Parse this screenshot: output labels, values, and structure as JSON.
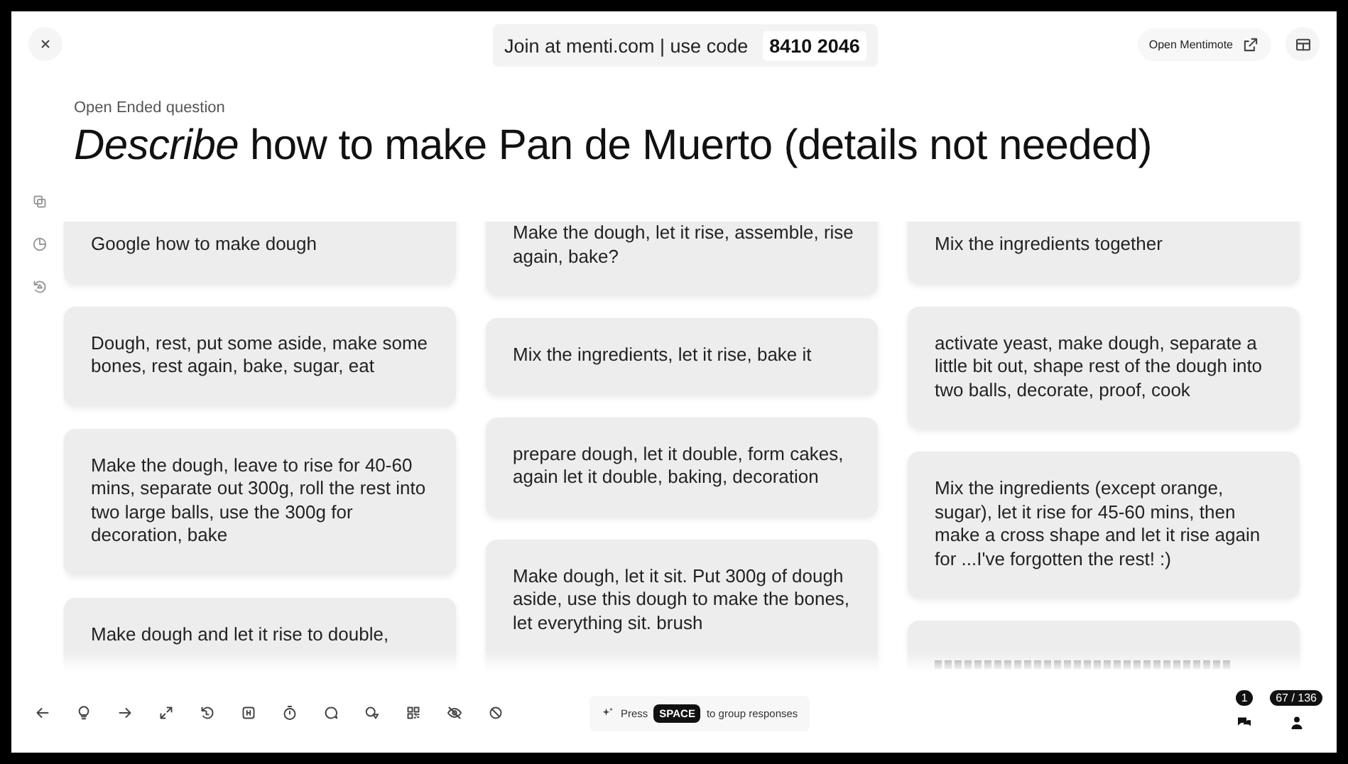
{
  "top_bar": {
    "join_text": "Join at menti.com | use code",
    "code": "8410 2046",
    "open_button": "Open Mentimote"
  },
  "question": {
    "type_label": "Open Ended question",
    "title": "*Describe* how to make Pan de Muerto (details not needed)"
  },
  "responses": [
    [
      {
        "text": "Google how to make dough"
      },
      {
        "text": "Dough, rest, put some aside, make some bones, rest again, bake, sugar, eat"
      },
      {
        "text": "Make the dough, leave to rise for 40-60 mins, separate out 300g, roll the rest into two large balls, use the 300g for decoration, bake"
      },
      {
        "text": "Make dough and let it rise to double,"
      }
    ],
    [
      {
        "text": "Make the dough, let it rise, assemble, rise again, bake?"
      },
      {
        "text": "Mix the ingredients, let it rise, bake it"
      },
      {
        "text": "prepare dough, let it double, form cakes, again let it double, baking, decoration"
      },
      {
        "text": "Make dough, let it sit. Put 300g of dough aside, use this dough to make the bones, let everything sit. brush"
      }
    ],
    [
      {
        "text": "Mix the ingredients together"
      },
      {
        "text": "activate yeast, make dough, separate a little bit out, shape rest of the dough into two balls, decorate, proof, cook"
      },
      {
        "text": "Mix the ingredients (except orange, sugar), let it rise for 45-60 mins, then make a cross shape and let it rise again for ...I've forgotten the rest! :)"
      },
      {
        "kind": "cut"
      }
    ]
  ],
  "toolbar": {
    "hint_prefix": "Press",
    "key": "SPACE",
    "hint_suffix": "to group responses",
    "comment_count": "1",
    "participants": "67 / 136"
  }
}
